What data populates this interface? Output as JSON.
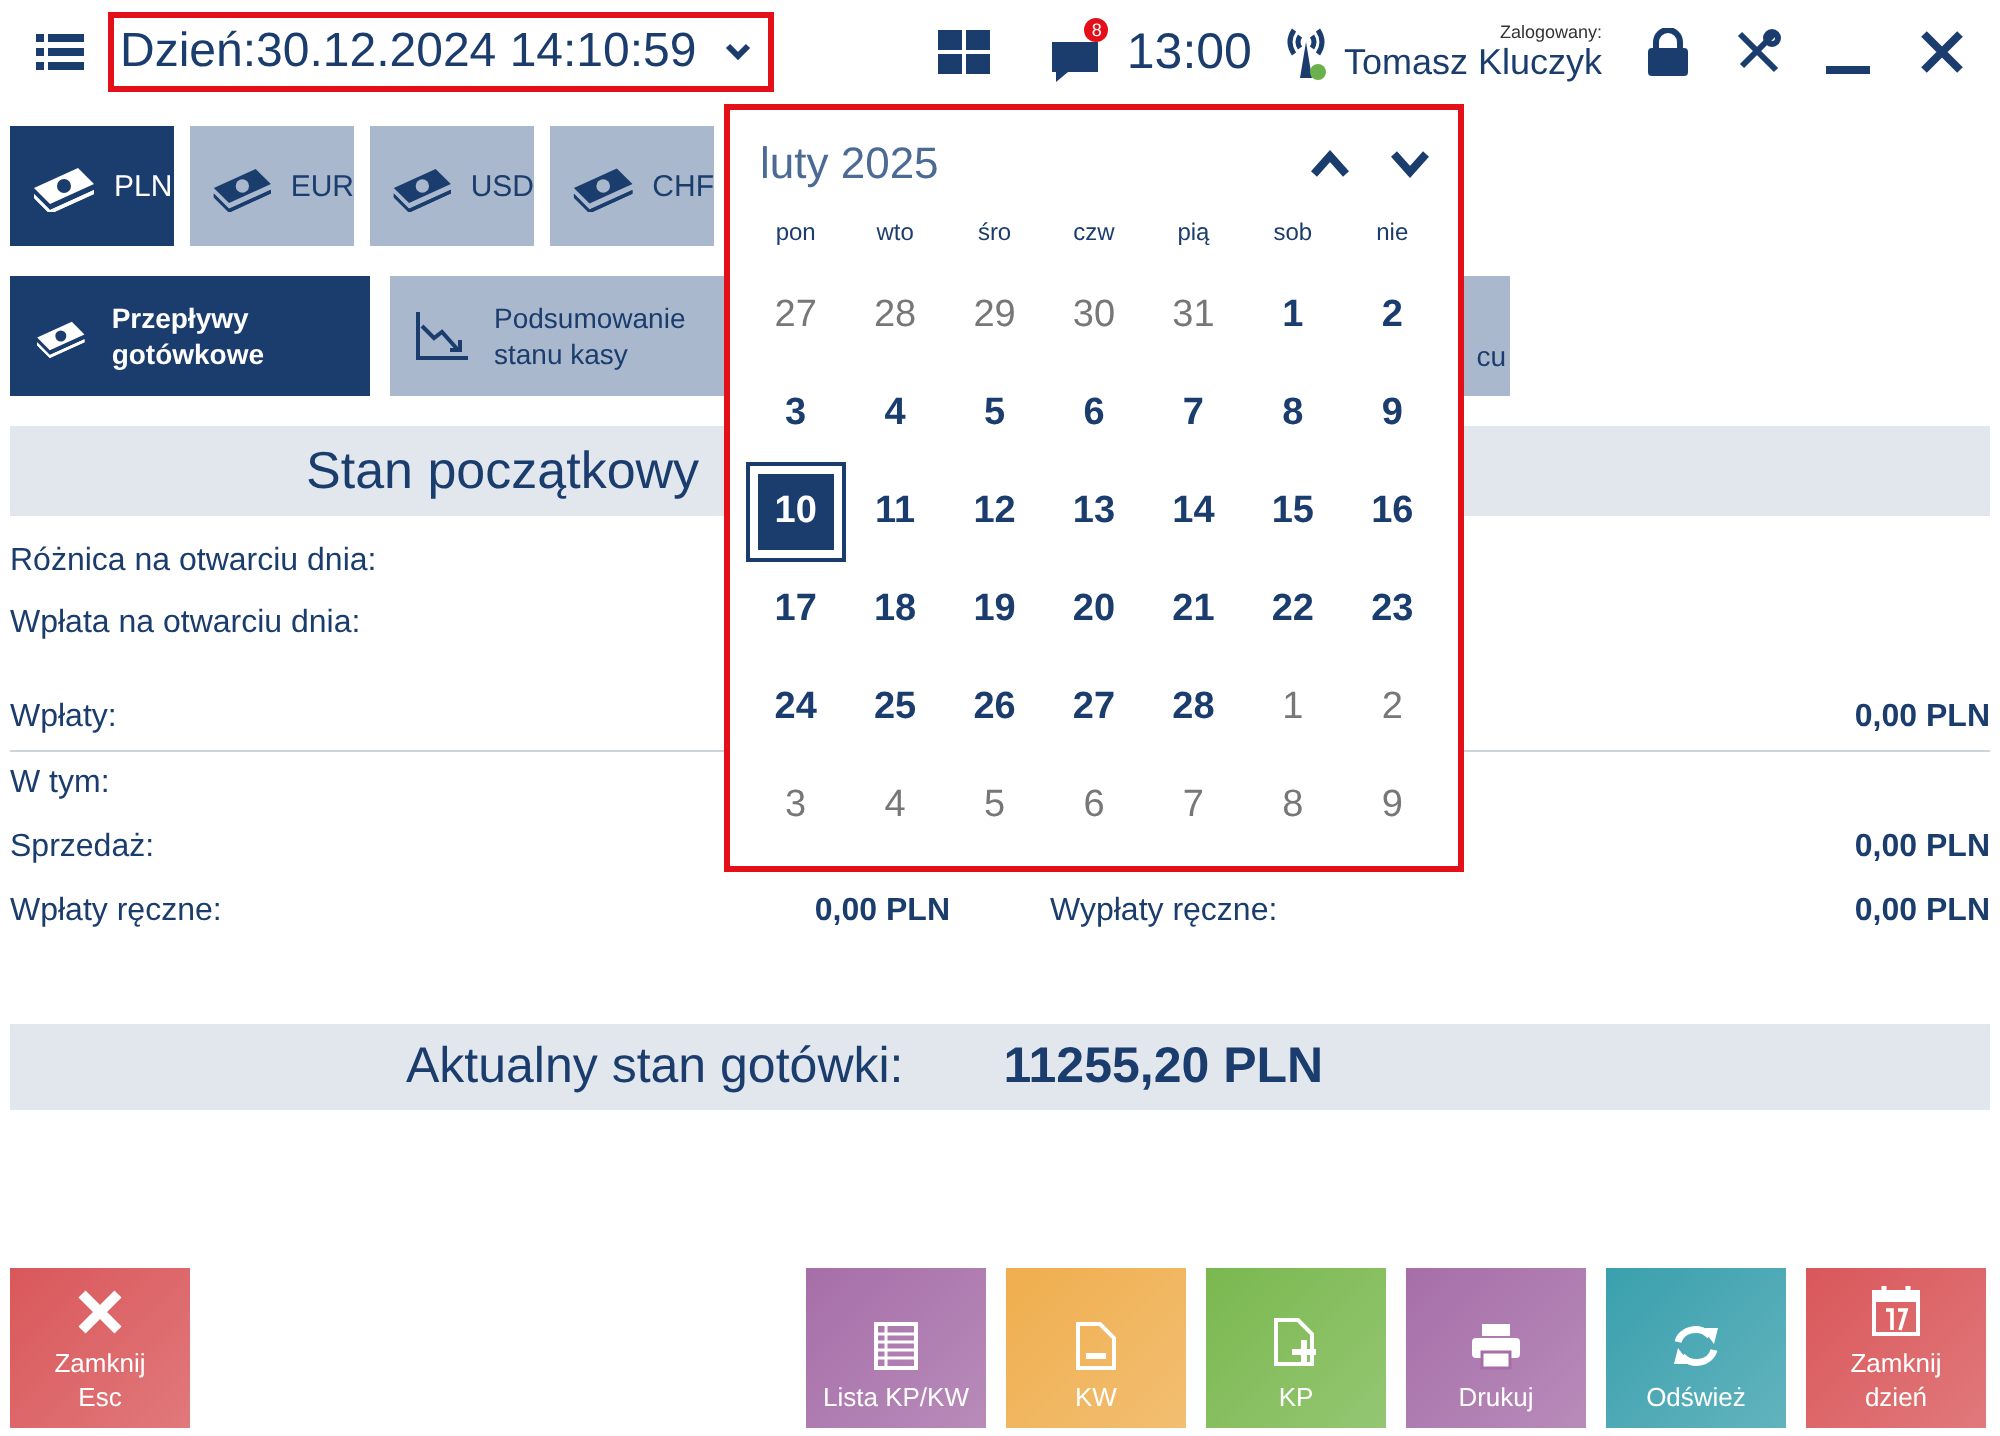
{
  "top_bar": {
    "date_label": "Dzień:30.12.2024 14:10:59",
    "notification_count": "8",
    "time": "13:00",
    "user_caption": "Zalogowany:",
    "user_name": "Tomasz Kluczyk"
  },
  "currency_tabs": [
    {
      "label": "PLN",
      "selected": true
    },
    {
      "label": "EUR",
      "selected": false
    },
    {
      "label": "USD",
      "selected": false
    },
    {
      "label": "CHF",
      "selected": false
    }
  ],
  "view_tabs": [
    {
      "label": "Przepływy gotówkowe",
      "kind": "cash",
      "selected": true
    },
    {
      "label": "Podsumowanie stanu kasy",
      "kind": "chart",
      "selected": false
    },
    {
      "label": "cu",
      "kind": "partial",
      "selected": false
    }
  ],
  "opening_section": {
    "title": "Stan początkowy",
    "rows": [
      {
        "label": "Różnica na otwarciu dnia:"
      },
      {
        "label": "Wpłata na otwarciu dnia:"
      }
    ]
  },
  "flow_rows": [
    {
      "left_label": "Wpłaty:",
      "left_value": "",
      "right_label": "",
      "right_value": "0,00 PLN",
      "divider": true
    },
    {
      "left_label": "W tym:",
      "left_value": "",
      "right_label": "",
      "right_value": "",
      "divider": false
    },
    {
      "left_label": "Sprzedaż:",
      "left_value": "",
      "right_label": "",
      "right_value": "0,00 PLN",
      "divider": false
    },
    {
      "left_label": "Wpłaty ręczne:",
      "left_value": "0,00 PLN",
      "right_label": "Wypłaty ręczne:",
      "right_value": "0,00 PLN",
      "divider": false
    }
  ],
  "current_balance": {
    "label": "Aktualny stan gotówki:",
    "value": "11255,20 PLN"
  },
  "calendar": {
    "month_label": "luty 2025",
    "weekdays": [
      "pon",
      "wto",
      "śro",
      "czw",
      "pią",
      "sob",
      "nie"
    ],
    "weeks": [
      [
        {
          "label": "27",
          "in_month": false,
          "selected": false
        },
        {
          "label": "28",
          "in_month": false,
          "selected": false
        },
        {
          "label": "29",
          "in_month": false,
          "selected": false
        },
        {
          "label": "30",
          "in_month": false,
          "selected": false
        },
        {
          "label": "31",
          "in_month": false,
          "selected": false
        },
        {
          "label": "1",
          "in_month": true,
          "selected": false
        },
        {
          "label": "2",
          "in_month": true,
          "selected": false
        }
      ],
      [
        {
          "label": "3",
          "in_month": true,
          "selected": false
        },
        {
          "label": "4",
          "in_month": true,
          "selected": false
        },
        {
          "label": "5",
          "in_month": true,
          "selected": false
        },
        {
          "label": "6",
          "in_month": true,
          "selected": false
        },
        {
          "label": "7",
          "in_month": true,
          "selected": false
        },
        {
          "label": "8",
          "in_month": true,
          "selected": false
        },
        {
          "label": "9",
          "in_month": true,
          "selected": false
        }
      ],
      [
        {
          "label": "10",
          "in_month": true,
          "selected": true
        },
        {
          "label": "11",
          "in_month": true,
          "selected": false
        },
        {
          "label": "12",
          "in_month": true,
          "selected": false
        },
        {
          "label": "13",
          "in_month": true,
          "selected": false
        },
        {
          "label": "14",
          "in_month": true,
          "selected": false
        },
        {
          "label": "15",
          "in_month": true,
          "selected": false
        },
        {
          "label": "16",
          "in_month": true,
          "selected": false
        }
      ],
      [
        {
          "label": "17",
          "in_month": true,
          "selected": false
        },
        {
          "label": "18",
          "in_month": true,
          "selected": false
        },
        {
          "label": "19",
          "in_month": true,
          "selected": false
        },
        {
          "label": "20",
          "in_month": true,
          "selected": false
        },
        {
          "label": "21",
          "in_month": true,
          "selected": false
        },
        {
          "label": "22",
          "in_month": true,
          "selected": false
        },
        {
          "label": "23",
          "in_month": true,
          "selected": false
        }
      ],
      [
        {
          "label": "24",
          "in_month": true,
          "selected": false
        },
        {
          "label": "25",
          "in_month": true,
          "selected": false
        },
        {
          "label": "26",
          "in_month": true,
          "selected": false
        },
        {
          "label": "27",
          "in_month": true,
          "selected": false
        },
        {
          "label": "28",
          "in_month": true,
          "selected": false
        },
        {
          "label": "1",
          "in_month": false,
          "selected": false
        },
        {
          "label": "2",
          "in_month": false,
          "selected": false
        }
      ],
      [
        {
          "label": "3",
          "in_month": false,
          "selected": false
        },
        {
          "label": "4",
          "in_month": false,
          "selected": false
        },
        {
          "label": "5",
          "in_month": false,
          "selected": false
        },
        {
          "label": "6",
          "in_month": false,
          "selected": false
        },
        {
          "label": "7",
          "in_month": false,
          "selected": false
        },
        {
          "label": "8",
          "in_month": false,
          "selected": false
        },
        {
          "label": "9",
          "in_month": false,
          "selected": false
        }
      ]
    ]
  },
  "footer_buttons": [
    {
      "label": "Zamknij\nEsc",
      "kind": "close",
      "color": "#d9575a"
    },
    {
      "label": "Lista KP/KW",
      "kind": "list",
      "color": "#a66ea8"
    },
    {
      "label": "KW",
      "kind": "kw",
      "color": "#efae4e"
    },
    {
      "label": "KP",
      "kind": "kp",
      "color": "#7ab84f"
    },
    {
      "label": "Drukuj",
      "kind": "print",
      "color": "#a66ea8"
    },
    {
      "label": "Odśwież",
      "kind": "refresh",
      "color": "#3aa0ad"
    },
    {
      "label": "Zamknij\ndzień",
      "kind": "day",
      "color": "#d9575a"
    }
  ]
}
